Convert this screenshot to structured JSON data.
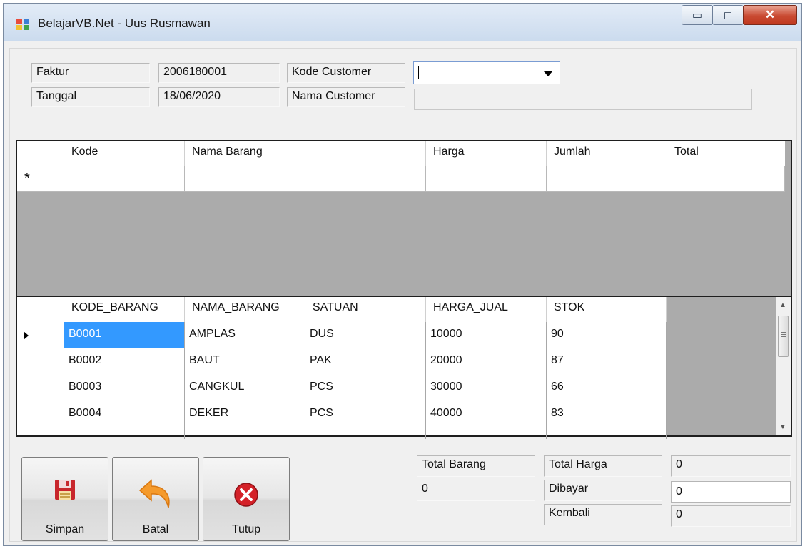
{
  "window": {
    "title": "BelajarVB.Net - Uus Rusmawan"
  },
  "header": {
    "faktur_label": "Faktur",
    "faktur_value": "2006180001",
    "tanggal_label": "Tanggal",
    "tanggal_value": "18/06/2020",
    "kode_customer_label": "Kode Customer",
    "kode_customer_value": "",
    "nama_customer_label": "Nama Customer",
    "nama_customer_value": ""
  },
  "transaction_grid": {
    "columns": [
      "Kode",
      "Nama Barang",
      "Harga",
      "Jumlah",
      "Total"
    ],
    "new_row_marker": "*"
  },
  "items_grid": {
    "columns": [
      "KODE_BARANG",
      "NAMA_BARANG",
      "SATUAN",
      "HARGA_JUAL",
      "STOK"
    ],
    "rows": [
      [
        "B0001",
        "AMPLAS",
        "DUS",
        "10000",
        "90"
      ],
      [
        "B0002",
        "BAUT",
        "PAK",
        "20000",
        "87"
      ],
      [
        "B0003",
        "CANGKUL",
        "PCS",
        "30000",
        "66"
      ],
      [
        "B0004",
        "DEKER",
        "PCS",
        "40000",
        "83"
      ]
    ]
  },
  "buttons": {
    "simpan": "Simpan",
    "batal": "Batal",
    "tutup": "Tutup"
  },
  "totals": {
    "total_barang_label": "Total Barang",
    "total_barang_value": "0",
    "total_harga_label": "Total Harga",
    "total_harga_value": "0",
    "dibayar_label": "Dibayar",
    "dibayar_value": "0",
    "kembali_label": "Kembali",
    "kembali_value": "0"
  },
  "colors": {
    "selection": "#3399ff",
    "grid_background": "#ababab",
    "close_button": "#c94a32"
  }
}
